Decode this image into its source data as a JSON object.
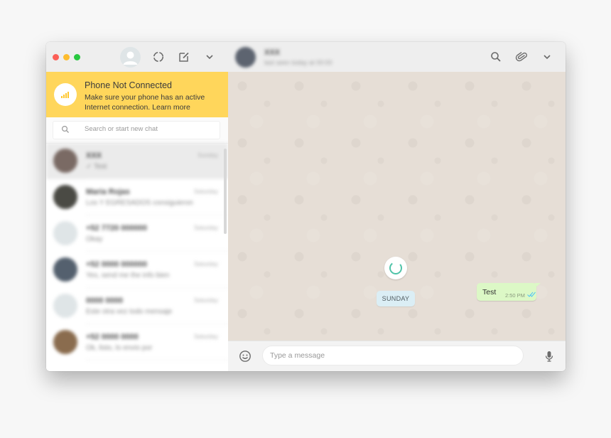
{
  "banner": {
    "title": "Phone Not Connected",
    "text": "Make sure your phone has an active Internet connection. Learn more"
  },
  "search": {
    "placeholder": "Search or start new chat"
  },
  "chat_list": [
    {
      "name": "XXX",
      "preview": "✓ Test",
      "time": "Sunday",
      "avatar_color": "#7a6a64",
      "selected": true
    },
    {
      "name": "Maria Rojas",
      "preview": "Los Y EGRESADOS consiguieron",
      "time": "Saturday",
      "avatar_color": "#4a4a44",
      "selected": false
    },
    {
      "name": "+52 7720 000000",
      "preview": "Okay",
      "time": "Saturday",
      "avatar_color": "#dfe5e7",
      "selected": false
    },
    {
      "name": "+52 0000 000000",
      "preview": "Yes, send me the info bien",
      "time": "Saturday",
      "avatar_color": "#54606e",
      "selected": false
    },
    {
      "name": "0000 0000",
      "preview": "Este otra vez todo mensaje",
      "time": "Saturday",
      "avatar_color": "#dfe5e7",
      "selected": false
    },
    {
      "name": "+52 0000 0000",
      "preview": "Ok, listo, lo envio por",
      "time": "Saturday",
      "avatar_color": "#8a6c4e",
      "selected": false
    }
  ],
  "contact": {
    "name": "XXX",
    "status": "last seen today at 00:00"
  },
  "day_chip": "SUNDAY",
  "message": {
    "text": "Test",
    "time": "2:50 PM"
  },
  "composer": {
    "placeholder": "Type a message"
  },
  "colors": {
    "banner": "#ffd65b",
    "bubble": "#dcf8c6",
    "chat_bg": "#e6ded6",
    "day_chip": "#dbeef5"
  }
}
